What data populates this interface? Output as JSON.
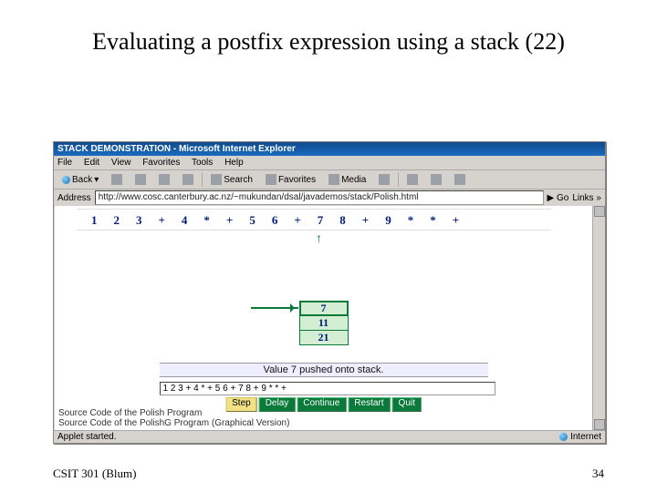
{
  "slide": {
    "title": "Evaluating a postfix expression using a stack (22)",
    "footer_left": "CSIT 301 (Blum)",
    "page_number": "34"
  },
  "window": {
    "title": "STACK DEMONSTRATION - Microsoft Internet Explorer",
    "menu": [
      "File",
      "Edit",
      "View",
      "Favorites",
      "Tools",
      "Help"
    ],
    "toolbar": {
      "back": "Back",
      "search": "Search",
      "favorites": "Favorites",
      "media": "Media"
    },
    "address_label": "Address",
    "address_value": "http://www.cosc.canterbury.ac.nz/~mukundan/dsal/javademos/stack/Polish.html",
    "go": "Go",
    "links": "Links »",
    "status_left": "Applet started.",
    "status_right": "Internet"
  },
  "applet": {
    "tokens": [
      "1",
      "2",
      "3",
      "+",
      "4",
      "*",
      "+",
      "5",
      "6",
      "+",
      "7",
      "8",
      "+",
      "9",
      "*",
      "*",
      "+"
    ],
    "arrow_index": 10,
    "stack": [
      "7",
      "11",
      "21"
    ],
    "message": "Value 7 pushed onto stack.",
    "input_value": "1 2 3 + 4 * + 5 6 + 7 8 + 9 * * +",
    "buttons": [
      {
        "label": "Step",
        "active": true
      },
      {
        "label": "Delay",
        "active": false
      },
      {
        "label": "Continue",
        "active": false
      },
      {
        "label": "Restart",
        "active": false
      },
      {
        "label": "Quit",
        "active": false
      }
    ],
    "src1": "Source Code of the Polish Program",
    "src2": "Source Code of the PolishG Program (Graphical Version)"
  }
}
